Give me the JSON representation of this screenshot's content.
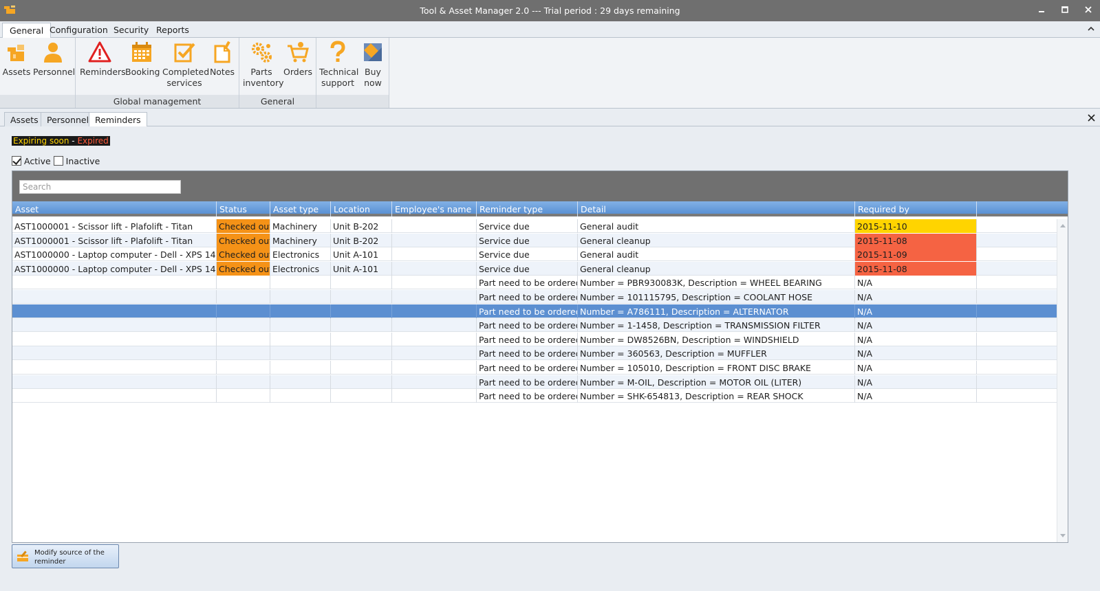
{
  "window": {
    "title": "Tool & Asset Manager 2.0 --- Trial period : 29 days remaining"
  },
  "menu": {
    "tabs": [
      {
        "label": "General",
        "active": true
      },
      {
        "label": "Configuration",
        "active": false
      },
      {
        "label": "Security",
        "active": false
      },
      {
        "label": "Reports",
        "active": false
      }
    ]
  },
  "ribbon": {
    "groups": [
      {
        "label": ""
      },
      {
        "label": "Global management"
      },
      {
        "label": "General"
      },
      {
        "label": ""
      }
    ],
    "buttons": [
      {
        "label": "Assets",
        "icon": "assets-icon"
      },
      {
        "label": "Personnel",
        "icon": "personnel-icon"
      },
      {
        "label": "Reminders",
        "icon": "warning-icon"
      },
      {
        "label": "Booking",
        "icon": "calendar-icon"
      },
      {
        "label": "Completed services",
        "icon": "checklist-icon"
      },
      {
        "label": "Notes",
        "icon": "note-icon"
      },
      {
        "label": "Parts inventory",
        "icon": "gears-icon"
      },
      {
        "label": "Orders",
        "icon": "cart-icon"
      },
      {
        "label": "Technical support",
        "icon": "question-icon"
      },
      {
        "label": "Buy now",
        "icon": "buy-icon"
      }
    ]
  },
  "doc_tabs": [
    {
      "label": "Assets",
      "active": false
    },
    {
      "label": "Personnel",
      "active": false
    },
    {
      "label": "Reminders",
      "active": true
    }
  ],
  "legend": {
    "expiring": "Expiring soon",
    "separator": " - ",
    "expired": "Expired"
  },
  "filters": {
    "active_label": "Active",
    "active_checked": true,
    "inactive_label": "Inactive",
    "inactive_checked": false
  },
  "search": {
    "placeholder": "Search"
  },
  "columns": [
    "Asset",
    "Status",
    "Asset type",
    "Location",
    "Employee's name",
    "Reminder type",
    "Detail",
    "Required by"
  ],
  "rows": [
    {
      "asset": "AST1000001 - Scissor lift - Plafolift - Titan",
      "status": "Checked out",
      "type": "Machinery",
      "location": "Unit B-202",
      "employee": "",
      "reminder": "Service due",
      "detail": "General audit",
      "required": "2015-11-10",
      "req_state": "expiring"
    },
    {
      "asset": "AST1000001 - Scissor lift - Plafolift - Titan",
      "status": "Checked out",
      "type": "Machinery",
      "location": "Unit B-202",
      "employee": "",
      "reminder": "Service due",
      "detail": "General cleanup",
      "required": "2015-11-08",
      "req_state": "expired"
    },
    {
      "asset": "AST1000000 - Laptop computer - Dell - XPS 14",
      "status": "Checked out",
      "type": "Electronics",
      "location": "Unit A-101",
      "employee": "",
      "reminder": "Service due",
      "detail": "General audit",
      "required": "2015-11-09",
      "req_state": "expired"
    },
    {
      "asset": "AST1000000 - Laptop computer - Dell - XPS 14",
      "status": "Checked out",
      "type": "Electronics",
      "location": "Unit A-101",
      "employee": "",
      "reminder": "Service due",
      "detail": "General cleanup",
      "required": "2015-11-08",
      "req_state": "expired"
    },
    {
      "asset": "",
      "status": "",
      "type": "",
      "location": "",
      "employee": "",
      "reminder": "Part need to be ordered",
      "detail": "Number = PBR930083K, Description = WHEEL BEARING",
      "required": "N/A",
      "req_state": ""
    },
    {
      "asset": "",
      "status": "",
      "type": "",
      "location": "",
      "employee": "",
      "reminder": "Part need to be ordered",
      "detail": "Number = 101115795, Description = COOLANT HOSE",
      "required": "N/A",
      "req_state": ""
    },
    {
      "asset": "",
      "status": "",
      "type": "",
      "location": "",
      "employee": "",
      "reminder": "Part need to be ordered",
      "detail": "Number = A786111, Description = ALTERNATOR",
      "required": "N/A",
      "req_state": "",
      "selected": true
    },
    {
      "asset": "",
      "status": "",
      "type": "",
      "location": "",
      "employee": "",
      "reminder": "Part need to be ordered",
      "detail": "Number = 1-1458, Description = TRANSMISSION FILTER",
      "required": "N/A",
      "req_state": ""
    },
    {
      "asset": "",
      "status": "",
      "type": "",
      "location": "",
      "employee": "",
      "reminder": "Part need to be ordered",
      "detail": "Number = DW8526BN, Description = WINDSHIELD",
      "required": "N/A",
      "req_state": ""
    },
    {
      "asset": "",
      "status": "",
      "type": "",
      "location": "",
      "employee": "",
      "reminder": "Part need to be ordered",
      "detail": "Number = 360563, Description = MUFFLER",
      "required": "N/A",
      "req_state": ""
    },
    {
      "asset": "",
      "status": "",
      "type": "",
      "location": "",
      "employee": "",
      "reminder": "Part need to be ordered",
      "detail": "Number = 105010, Description = FRONT DISC BRAKE",
      "required": "N/A",
      "req_state": ""
    },
    {
      "asset": "",
      "status": "",
      "type": "",
      "location": "",
      "employee": "",
      "reminder": "Part need to be ordered",
      "detail": "Number = M-OIL, Description = MOTOR OIL (LITER)",
      "required": "N/A",
      "req_state": ""
    },
    {
      "asset": "",
      "status": "",
      "type": "",
      "location": "",
      "employee": "",
      "reminder": "Part need to be ordered",
      "detail": "Number = SHK-654813, Description = REAR SHOCK",
      "required": "N/A",
      "req_state": ""
    }
  ],
  "actions": {
    "modify_label": "Modify source of the reminder"
  },
  "colors": {
    "status_checked_out": "#f59217",
    "expiring": "#ffd400",
    "expired": "#f56343",
    "header": "#5a91d4",
    "selected": "#5c8fd1"
  }
}
